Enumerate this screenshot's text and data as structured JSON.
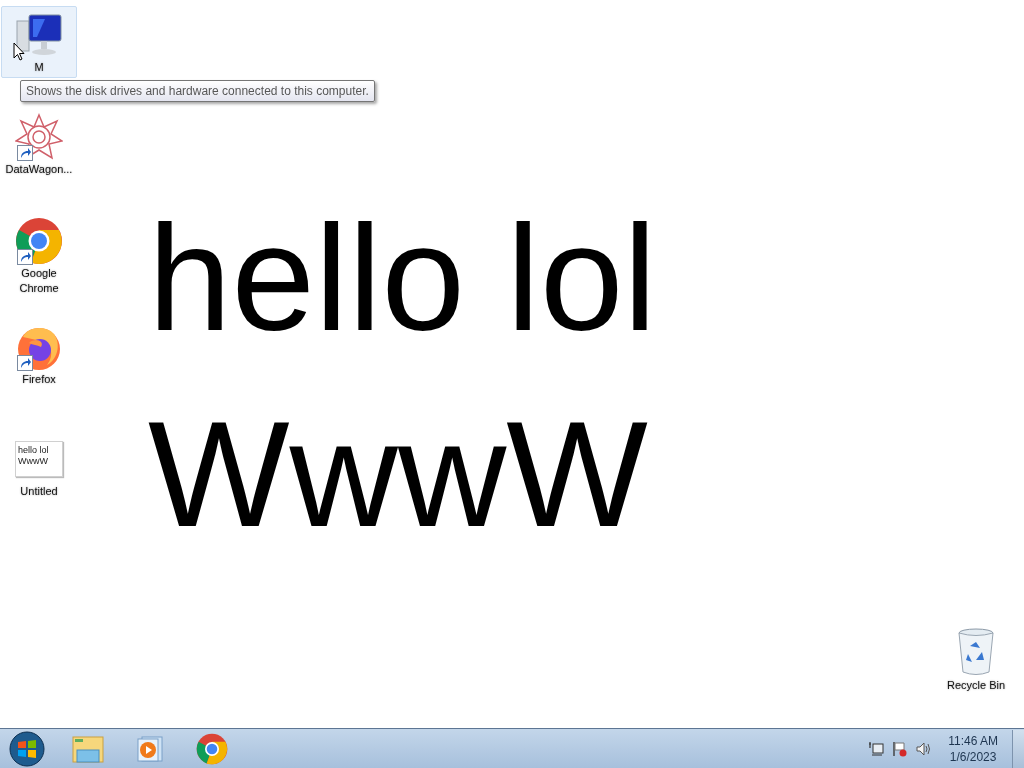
{
  "wallpaper": {
    "lines": [
      "hello lol",
      "WwwW"
    ]
  },
  "desktop_icons": [
    {
      "kind": "computer",
      "label": "M",
      "selected": true
    },
    {
      "kind": "datawagon",
      "label": "DataWagon...",
      "selected": false
    },
    {
      "kind": "chrome",
      "label": "Google Chrome",
      "selected": false
    },
    {
      "kind": "firefox",
      "label": "Firefox",
      "selected": false
    },
    {
      "kind": "document",
      "label": "Untitled",
      "selected": false,
      "thumbnail_lines": [
        "hello lol",
        "WwwW"
      ]
    }
  ],
  "recycle_bin": {
    "label": "Recycle Bin"
  },
  "tooltip": {
    "text": "Shows the disk drives and hardware connected to this computer."
  },
  "taskbar": {
    "pinned": [
      {
        "kind": "explorer"
      },
      {
        "kind": "media"
      },
      {
        "kind": "chrome"
      }
    ],
    "clock": {
      "time": "11:46 AM",
      "date": "1/6/2023"
    }
  }
}
